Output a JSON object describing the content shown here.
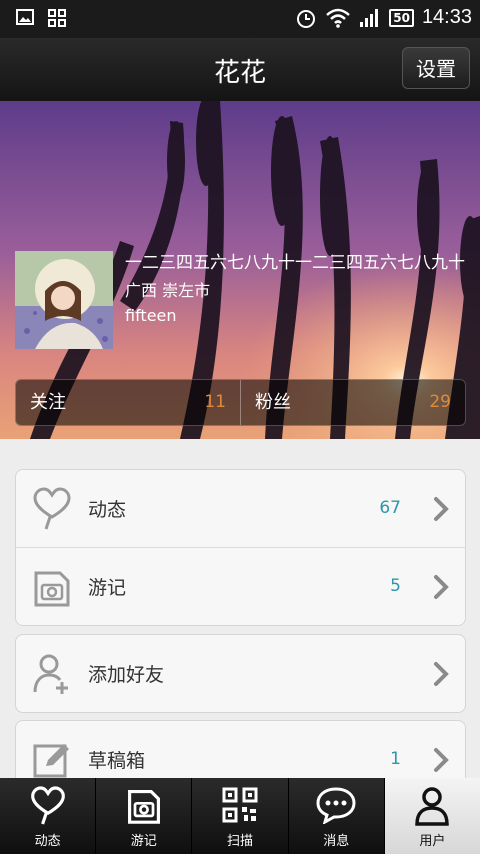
{
  "status_bar": {
    "time": "14:33",
    "battery": "50"
  },
  "nav": {
    "title": "花花",
    "settings_label": "设置"
  },
  "profile": {
    "bio": "一二三四五六七八九十一二三四五六七八九十",
    "location": "广西 崇左市",
    "handle": "fifteen",
    "following_label": "关注",
    "following_count": "11",
    "fans_label": "粉丝",
    "fans_count": "29"
  },
  "menu": {
    "group1": [
      {
        "label": "动态",
        "count": "67",
        "icon": "heart-pin-icon"
      },
      {
        "label": "游记",
        "count": "5",
        "icon": "camera-doc-icon"
      }
    ],
    "group2": [
      {
        "label": "添加好友",
        "count": "",
        "icon": "add-user-icon"
      }
    ],
    "group3": [
      {
        "label": "草稿箱",
        "count": "1",
        "icon": "edit-icon"
      }
    ]
  },
  "tabbar": {
    "tabs": [
      {
        "label": "动态",
        "icon": "heart-pin-icon"
      },
      {
        "label": "游记",
        "icon": "camera-doc-icon"
      },
      {
        "label": "扫描",
        "icon": "qr-code-icon"
      },
      {
        "label": "消息",
        "icon": "chat-bubble-icon"
      },
      {
        "label": "用户",
        "icon": "user-icon",
        "active": true
      }
    ]
  },
  "colors": {
    "accent_count": "#2b97a8",
    "stat_count": "#e08a3c"
  }
}
